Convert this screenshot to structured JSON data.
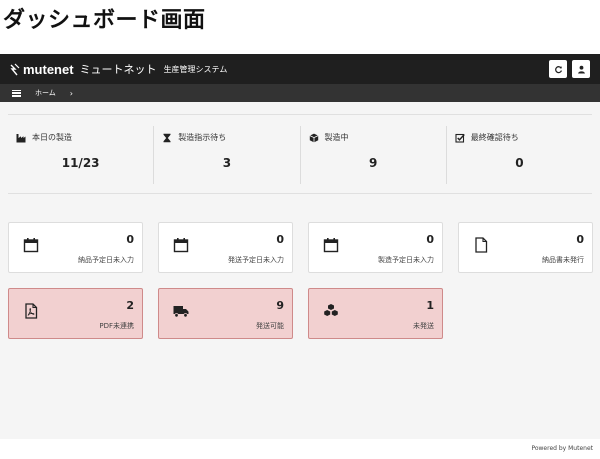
{
  "page_heading": "ダッシュボード画面",
  "header": {
    "logo": "mutenet",
    "name": "ミュートネット",
    "subtitle": "生産管理システム",
    "actions": [
      {
        "icon": "refresh-icon"
      },
      {
        "icon": "user-icon"
      }
    ]
  },
  "subnav": {
    "breadcrumb_home": "ホーム",
    "separator": "›"
  },
  "stats": [
    {
      "icon": "factory-icon",
      "label": "本日の製造",
      "value": "11/23"
    },
    {
      "icon": "hourglass-icon",
      "label": "製造指示待ち",
      "value": "3"
    },
    {
      "icon": "cube-icon",
      "label": "製造中",
      "value": "9"
    },
    {
      "icon": "check-square-icon",
      "label": "最終確認待ち",
      "value": "0"
    }
  ],
  "cards": [
    {
      "icon": "calendar-icon",
      "count": "0",
      "label": "納品予定日未入力",
      "alert": false
    },
    {
      "icon": "calendar-icon",
      "count": "0",
      "label": "発送予定日未入力",
      "alert": false
    },
    {
      "icon": "calendar-icon",
      "count": "0",
      "label": "製造予定日未入力",
      "alert": false
    },
    {
      "icon": "file-icon",
      "count": "0",
      "label": "納品書未発行",
      "alert": false
    },
    {
      "icon": "pdf-file-icon",
      "count": "2",
      "label": "PDF未連携",
      "alert": true
    },
    {
      "icon": "truck-icon",
      "count": "9",
      "label": "発送可能",
      "alert": true
    },
    {
      "icon": "cubes-icon",
      "count": "1",
      "label": "未発送",
      "alert": true
    }
  ],
  "footer": {
    "powered_by": "Powered by Mutenet"
  },
  "colors": {
    "topbar": "#1f1f1f",
    "subnav": "#333333",
    "content_bg": "#f5f5f5",
    "alert_bg": "#f2d0d0",
    "alert_border": "#cf8a8a"
  }
}
